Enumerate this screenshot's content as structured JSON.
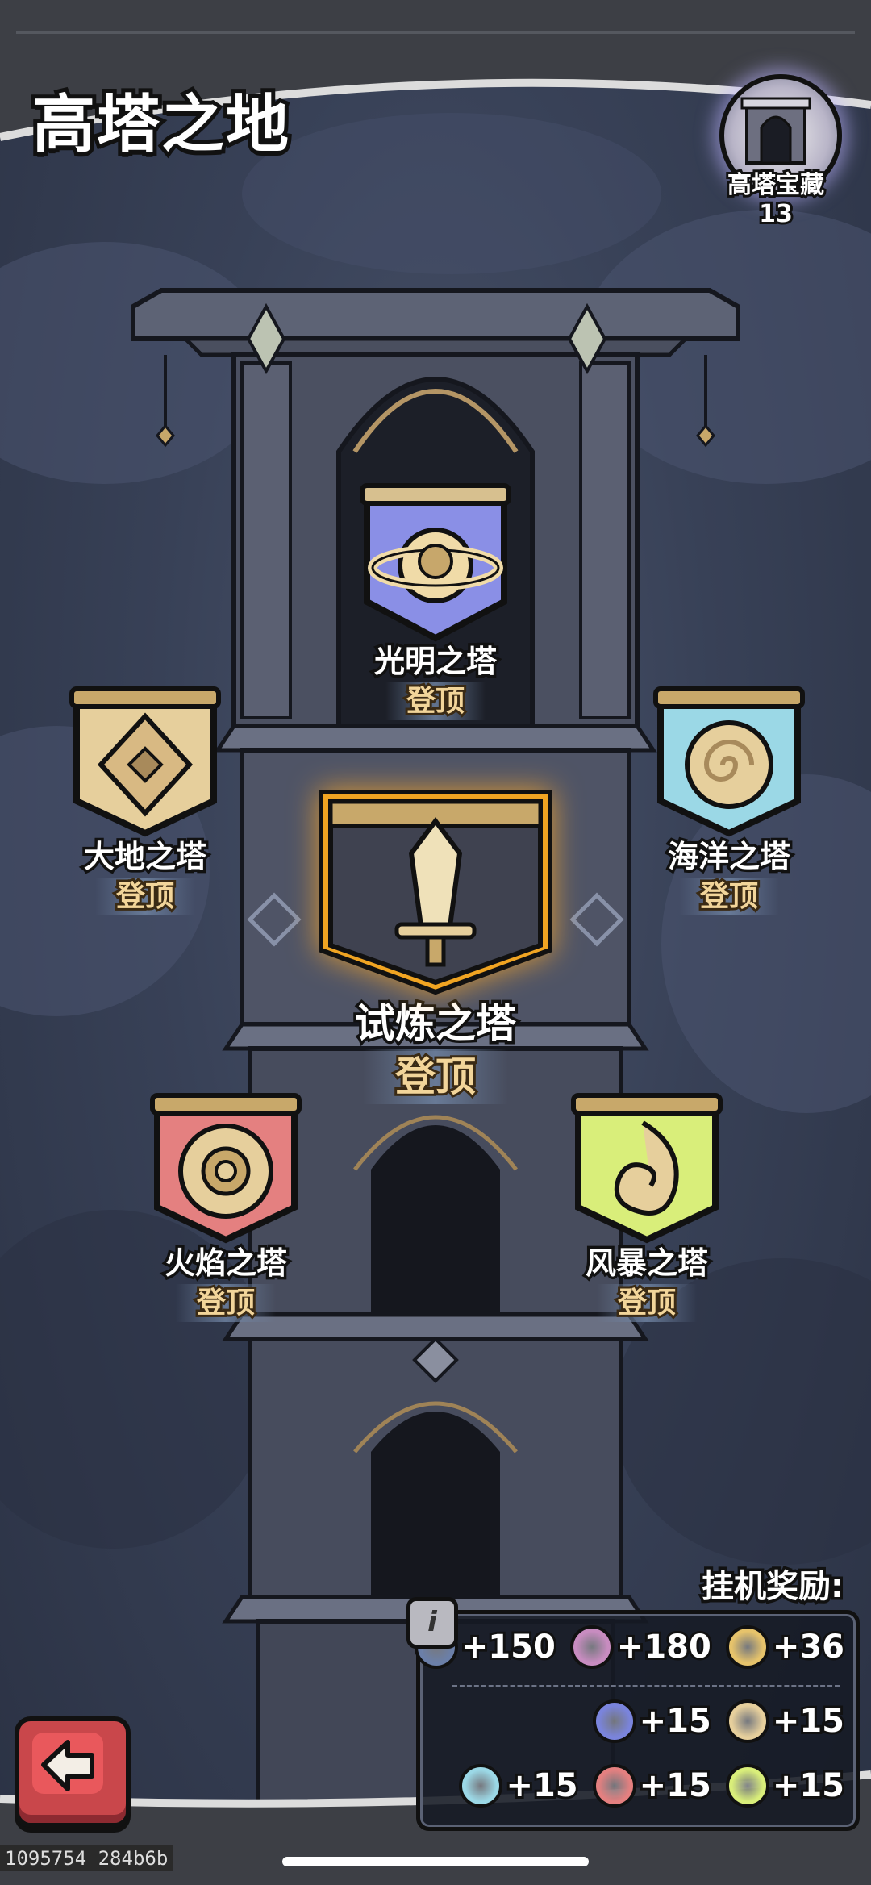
{
  "header": {
    "title": "高塔之地"
  },
  "treasure": {
    "label": "高塔宝藏",
    "count": "13"
  },
  "towers": [
    {
      "id": "light",
      "name": "光明之塔",
      "action": "登顶",
      "color": "#8a8fe6"
    },
    {
      "id": "earth",
      "name": "大地之塔",
      "action": "登顶",
      "color": "#e6cf9c"
    },
    {
      "id": "ocean",
      "name": "海洋之塔",
      "action": "登顶",
      "color": "#9bd8e6"
    },
    {
      "id": "trial",
      "name": "试炼之塔",
      "action": "登顶",
      "color": "#f0a422"
    },
    {
      "id": "fire",
      "name": "火焰之塔",
      "action": "登顶",
      "color": "#e48080"
    },
    {
      "id": "storm",
      "name": "风暴之塔",
      "action": "登顶",
      "color": "#d9ee7a"
    }
  ],
  "rewards": {
    "title": "挂机奖励:",
    "row1": [
      {
        "icon": "silver-chalice-icon",
        "value": "+150",
        "color": "#6b7fa8"
      },
      {
        "icon": "pink-chalice-icon",
        "value": "+180",
        "color": "#c88cc0"
      },
      {
        "icon": "golden-heart-icon",
        "value": "+36",
        "color": "#e6c36b"
      }
    ],
    "row2": [
      {
        "icon": "light-token-icon",
        "value": "+15",
        "color": "#7a84dc"
      },
      {
        "icon": "earth-token-icon",
        "value": "+15",
        "color": "#e6cf9c"
      }
    ],
    "row3": [
      {
        "icon": "ocean-token-icon",
        "value": "+15",
        "color": "#9bd8e6"
      },
      {
        "icon": "fire-token-icon",
        "value": "+15",
        "color": "#e48080"
      },
      {
        "icon": "storm-token-icon",
        "value": "+15",
        "color": "#d9ee7a"
      }
    ]
  },
  "debug_label": "1095754 284b6b"
}
